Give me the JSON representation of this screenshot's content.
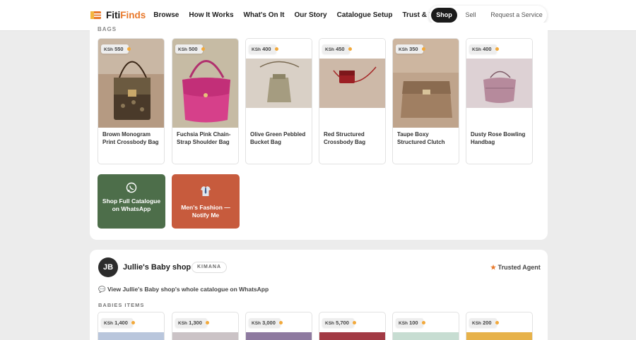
{
  "nav": {
    "brand_part1": "Fiti",
    "brand_part2": "Finds",
    "links": [
      "Browse",
      "How It Works",
      "What's On It",
      "Our Story",
      "Catalogue Setup",
      "Trust & Pricing"
    ],
    "toggle": {
      "shop": "Shop",
      "sell": "Sell",
      "request": "Request a Service"
    }
  },
  "section1": {
    "label_cut": "BAGS",
    "products": [
      {
        "currency": "KSh",
        "price": "550",
        "name": "Brown Monogram Print Crossbody Bag"
      },
      {
        "currency": "KSh",
        "price": "500",
        "name": "Fuchsia Pink Chain-Strap Shoulder Bag"
      },
      {
        "currency": "KSh",
        "price": "400",
        "name": "Olive Green Pebbled Bucket Bag"
      },
      {
        "currency": "KSh",
        "price": "450",
        "name": "Red Structured Crossbody Bag"
      },
      {
        "currency": "KSh",
        "price": "350",
        "name": "Taupe Boxy Structured Clutch"
      },
      {
        "currency": "KSh",
        "price": "400",
        "name": "Dusty Rose Bowling Handbag"
      }
    ],
    "cta_whatsapp": "Shop Full Catalogue on WhatsApp",
    "cta_men": "Men's Fashion — Notify Me"
  },
  "agent": {
    "initials": "JB",
    "shop_name": "Jullie's Baby shop",
    "location": "KIMANA",
    "trusted": "Trusted Agent",
    "whatsapp_link": "💬 View Jullie's Baby shop's whole catalogue on WhatsApp",
    "category_label": "BABIES ITEMS",
    "products": [
      {
        "currency": "KSh",
        "price": "1,400"
      },
      {
        "currency": "KSh",
        "price": "1,300"
      },
      {
        "currency": "KSh",
        "price": "3,000"
      },
      {
        "currency": "KSh",
        "price": "5,700"
      },
      {
        "currency": "KSh",
        "price": "100"
      },
      {
        "currency": "KSh",
        "price": "200"
      }
    ]
  },
  "colors": {
    "brand_orange": "#e8782a",
    "dark": "#1b1b1b",
    "whatsapp_green": "#4d6e4a",
    "men_orange": "#c75b3d"
  },
  "icons": {
    "logo": "striped-flag-icon",
    "whatsapp": "whatsapp-icon",
    "men": "shirt-tie-icon",
    "trusted": "star-icon"
  }
}
